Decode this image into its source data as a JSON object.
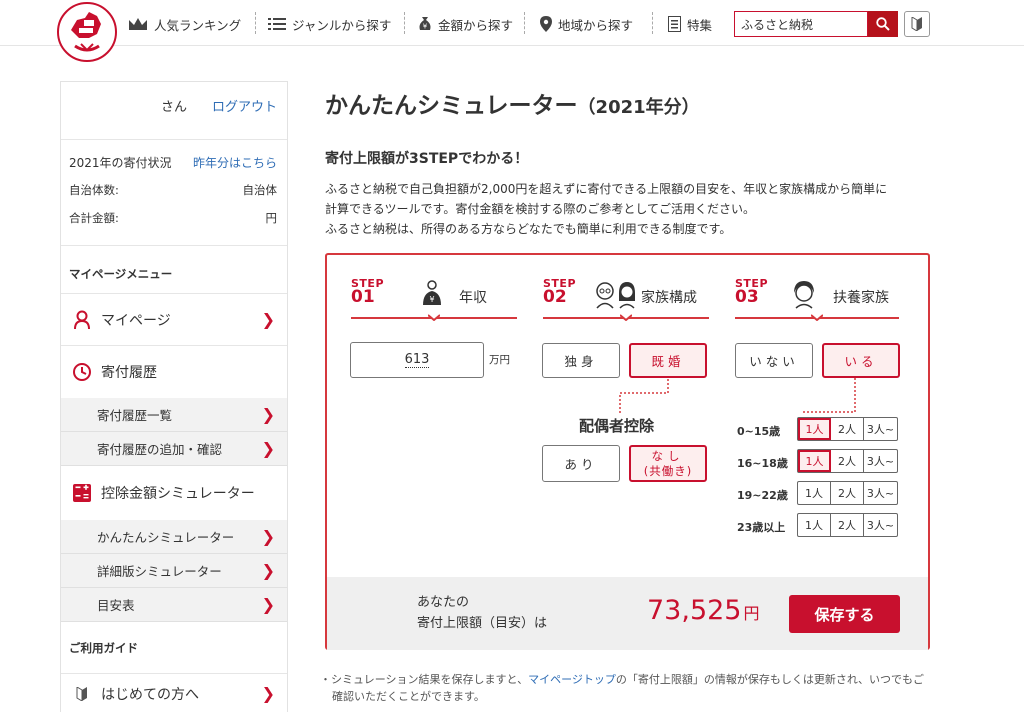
{
  "header": {
    "nav": [
      {
        "label": "人気ランキング",
        "icon": "crown-icon"
      },
      {
        "label": "ジャンルから探す",
        "icon": "list-icon"
      },
      {
        "label": "金額から探す",
        "icon": "money-bag-icon"
      },
      {
        "label": "地域から探す",
        "icon": "map-pin-icon"
      },
      {
        "label": "特集",
        "icon": "document-icon"
      }
    ],
    "search_value": "ふるさと納税"
  },
  "sidebar": {
    "user_suffix": "さん",
    "logout": "ログアウト",
    "status_title": "2021年の寄付状況",
    "last_year_link": "昨年分はこちら",
    "municipalities_label": "自治体数:",
    "municipalities_unit": "自治体",
    "total_label": "合計金額:",
    "total_unit": "円",
    "menu_title": "マイページメニュー",
    "mypage": "マイページ",
    "donation_history": "寄付履歴",
    "history_list": "寄付履歴一覧",
    "history_add": "寄付履歴の追加・確認",
    "deduction_sim": "控除金額シミュレーター",
    "easy_sim": "かんたんシミュレーター",
    "detail_sim": "詳細版シミュレーター",
    "guide_table": "目安表",
    "guide_title": "ご利用ガイド",
    "first_time": "はじめての方へ"
  },
  "main": {
    "title": "かんたんシミュレーター",
    "title_year": "（2021年分）",
    "subtitle": "寄付上限額が3STEPでわかる！",
    "desc1": "ふるさと納税で自己負担額が2,000円を超えずに寄付できる上限額の目安を、年収と家族構成から簡単に",
    "desc2": "計算できるツールです。寄付金額を検討する際のご参考としてご活用ください。",
    "desc3": "ふるさと納税は、所得のある方ならどなたでも簡単に利用できる制度です。"
  },
  "simulator": {
    "step_word": "STEP",
    "steps": [
      {
        "num": "01",
        "title": "年収"
      },
      {
        "num": "02",
        "title": "家族構成"
      },
      {
        "num": "03",
        "title": "扶養家族"
      }
    ],
    "income": "613",
    "income_unit": "万円",
    "single": "独身",
    "married": "既婚",
    "married_selected": true,
    "spouse_deduction_title": "配偶者控除",
    "spouse_yes": "あり",
    "spouse_no_line1": "なし",
    "spouse_no_line2": "(共働き)",
    "spouse_no_selected": true,
    "dependents_no": "いない",
    "dependents_yes": "いる",
    "dependents_yes_selected": true,
    "age_groups": [
      {
        "label": "0~15歳",
        "options": [
          "1人",
          "2人",
          "3人~"
        ],
        "selected": "1人"
      },
      {
        "label": "16~18歳",
        "options": [
          "1人",
          "2人",
          "3人~"
        ],
        "selected": "1人"
      },
      {
        "label": "19~22歳",
        "options": [
          "1人",
          "2人",
          "3人~"
        ],
        "selected": null
      },
      {
        "label": "23歳以上",
        "options": [
          "1人",
          "2人",
          "3人~"
        ],
        "selected": null
      }
    ],
    "result_line1": "あなたの",
    "result_line2": "寄付上限額（目安）は",
    "result_amount": "73,525",
    "result_unit": "円",
    "save": "保存する"
  },
  "note": {
    "bullet": "・",
    "text_before": "シミュレーション結果を保存しますと、",
    "link": "マイページトップ",
    "text_after": "の「寄付上限額」の情報が保存もしくは更新され、いつでもご",
    "text_line2": "確認いただくことができます。"
  },
  "colors": {
    "accent": "#c8102e",
    "link": "#2f6db5"
  }
}
